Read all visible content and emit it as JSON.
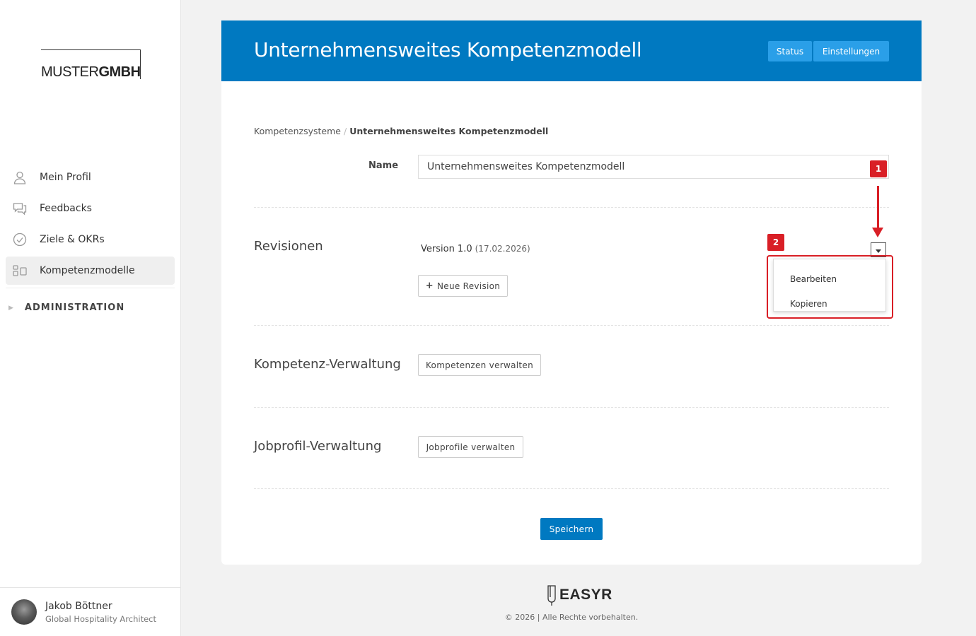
{
  "brand": {
    "logo_light": "MUSTER",
    "logo_bold": "GMBH"
  },
  "sidebar": {
    "items": [
      {
        "label": "Mein Profil",
        "icon": "user-icon"
      },
      {
        "label": "Feedbacks",
        "icon": "chat-bubbles-icon"
      },
      {
        "label": "Ziele & OKRs",
        "icon": "check-circle-icon"
      },
      {
        "label": "Kompetenzmodelle",
        "icon": "competence-model-icon",
        "active": true
      }
    ],
    "admin_label": "ADMINISTRATION",
    "user": {
      "name": "Jakob Böttner",
      "role": "Global Hospitality Architect"
    }
  },
  "header": {
    "title": "Unternehmensweites Kompetenzmodell",
    "status_label": "Status",
    "settings_label": "Einstellungen"
  },
  "breadcrumb": {
    "parent": "Kompetenzsysteme",
    "separator": "/",
    "current": "Unternehmensweites Kompetenzmodell"
  },
  "form": {
    "name_label": "Name",
    "name_value": "Unternehmensweites Kompetenzmodell"
  },
  "revisions": {
    "title": "Revisionen",
    "version": "Version 1.0",
    "date": "(17.02.2026)",
    "new_revision_label": "Neue Revision",
    "menu": [
      "Bearbeiten",
      "Kopieren"
    ]
  },
  "competence": {
    "title": "Kompetenz-Verwaltung",
    "button": "Kompetenzen verwalten"
  },
  "jobprofile": {
    "title": "Jobprofil-Verwaltung",
    "button": "Jobprofile verwalten"
  },
  "save_label": "Speichern",
  "annotations": {
    "badge1": "1",
    "badge2": "2"
  },
  "footer": {
    "brand": "EASYR",
    "copyright": "© 2026 | Alle Rechte vorbehalten."
  },
  "colors": {
    "primary": "#0079c1",
    "header_button": "#2a9fe8",
    "annotation": "#d91f26"
  }
}
